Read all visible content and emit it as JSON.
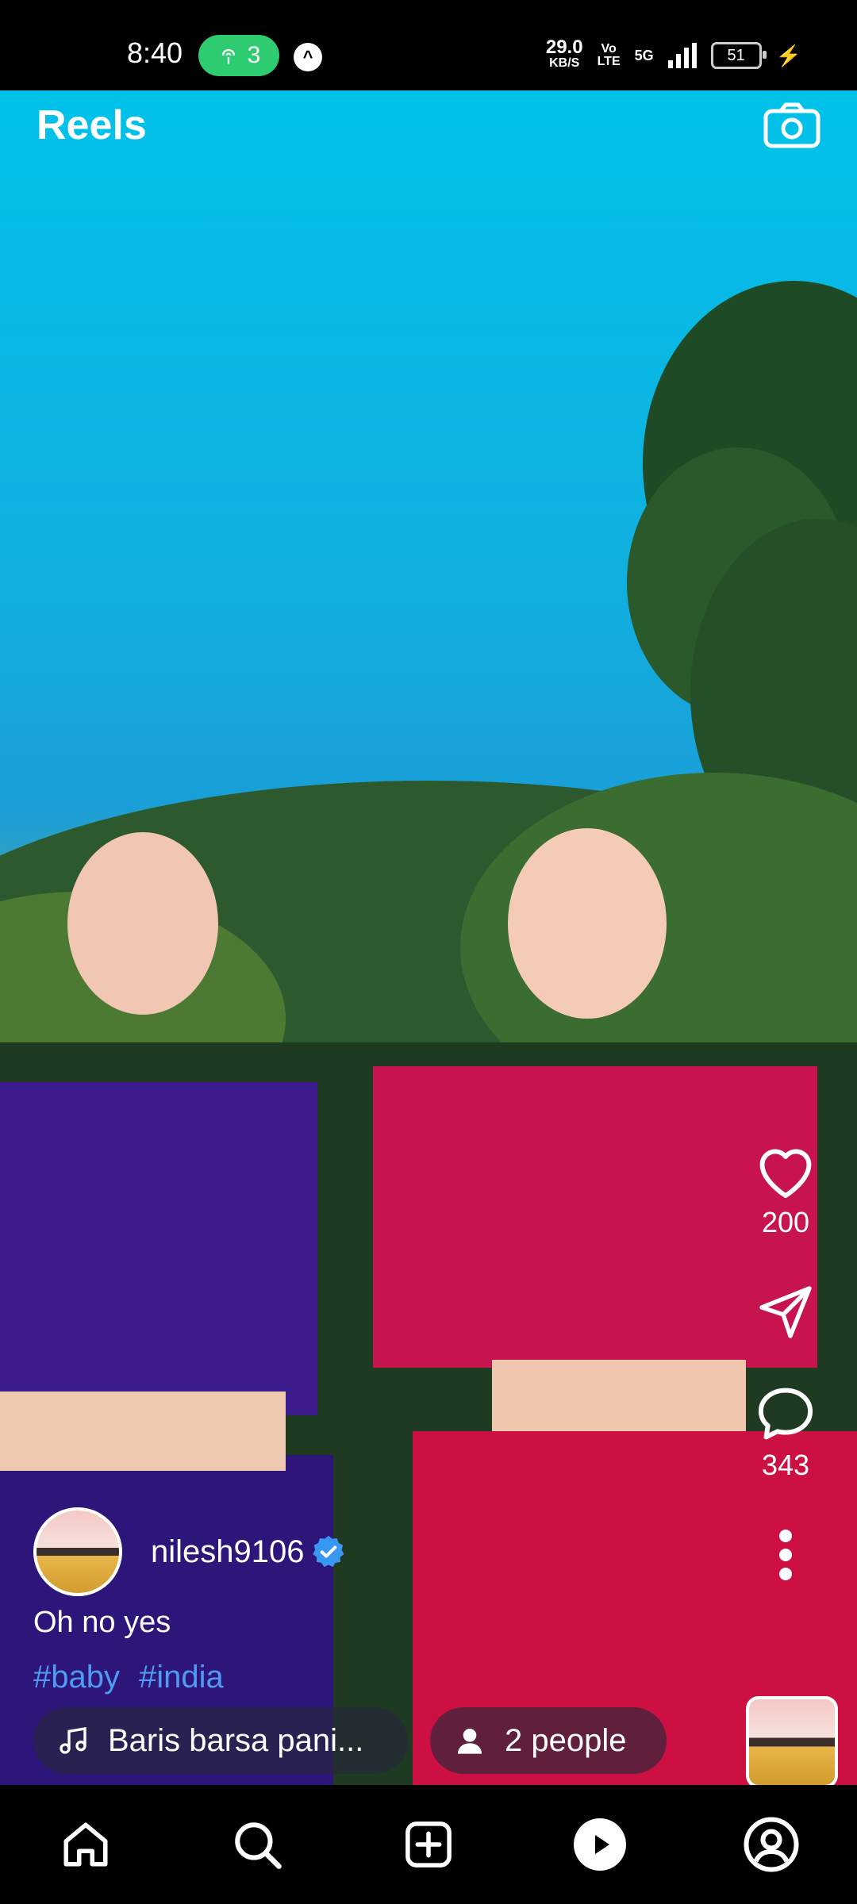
{
  "status_bar": {
    "time": "8:40",
    "hotspot_count": "3",
    "net_speed_value": "29.0",
    "net_speed_unit": "KB/S",
    "volte_top": "Vo",
    "volte_bottom": "LTE",
    "network": "5G",
    "battery": "51"
  },
  "header": {
    "title": "Reels",
    "camera_icon": "camera-icon"
  },
  "actions": {
    "likes": "200",
    "comments": "343"
  },
  "post": {
    "username": "nilesh9106",
    "caption": "Oh no yes",
    "hashtags": [
      "#baby",
      "#india"
    ],
    "music": "Baris barsa pani...",
    "people": "2 people"
  },
  "nav": {
    "items": [
      "home-icon",
      "search-icon",
      "create-icon",
      "reels-icon",
      "profile-icon"
    ]
  },
  "colors": {
    "hashtag": "#4f9bf2",
    "verified": "#3897f0",
    "hotspot": "#2ecc71"
  }
}
